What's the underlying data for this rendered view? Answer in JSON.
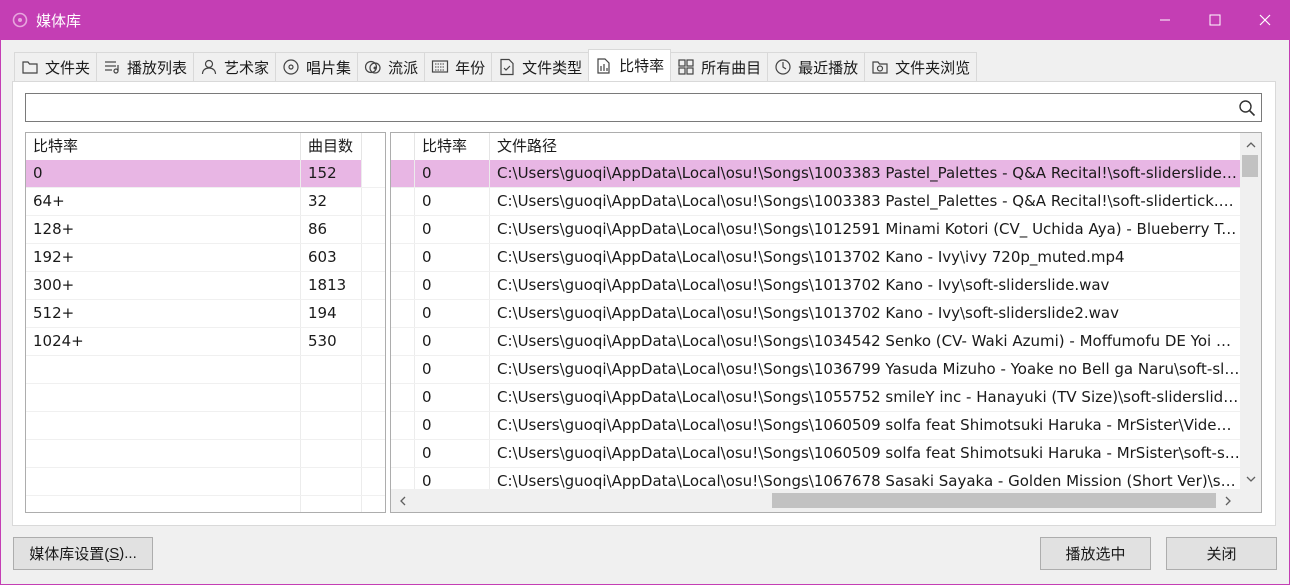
{
  "window": {
    "title": "媒体库",
    "accent": "#c43eb4",
    "selection_color": "#e8b6e4"
  },
  "tabs": [
    {
      "label": "文件夹",
      "icon": "folder-icon",
      "active": false
    },
    {
      "label": "播放列表",
      "icon": "playlist-icon",
      "active": false
    },
    {
      "label": "艺术家",
      "icon": "person-icon",
      "active": false
    },
    {
      "label": "唱片集",
      "icon": "disc-icon",
      "active": false
    },
    {
      "label": "流派",
      "icon": "genre-icon",
      "active": false
    },
    {
      "label": "年份",
      "icon": "calendar-icon",
      "active": false
    },
    {
      "label": "文件类型",
      "icon": "file-type-icon",
      "active": false
    },
    {
      "label": "比特率",
      "icon": "bitrate-icon",
      "active": true
    },
    {
      "label": "所有曲目",
      "icon": "grid-icon",
      "active": false
    },
    {
      "label": "最近播放",
      "icon": "recent-icon",
      "active": false
    },
    {
      "label": "文件夹浏览",
      "icon": "folder-browse-icon",
      "active": false
    }
  ],
  "search": {
    "value": "",
    "placeholder": ""
  },
  "left_list": {
    "headers": [
      "比特率",
      "曲目数"
    ],
    "rows": [
      [
        "0",
        "152"
      ],
      [
        "64+",
        "32"
      ],
      [
        "128+",
        "86"
      ],
      [
        "192+",
        "603"
      ],
      [
        "300+",
        "1813"
      ],
      [
        "512+",
        "194"
      ],
      [
        "1024+",
        "530"
      ]
    ],
    "selected_index": 0
  },
  "right_list": {
    "headers": [
      "",
      "比特率",
      "文件路径"
    ],
    "rows": [
      [
        "0",
        "C:\\Users\\guoqi\\AppData\\Local\\osu!\\Songs\\1003383 Pastel_Palettes - Q&A Recital!\\soft-sliderslide...."
      ],
      [
        "0",
        "C:\\Users\\guoqi\\AppData\\Local\\osu!\\Songs\\1003383 Pastel_Palettes - Q&A Recital!\\soft-slidertick.wav"
      ],
      [
        "0",
        "C:\\Users\\guoqi\\AppData\\Local\\osu!\\Songs\\1012591 Minami Kotori (CV_ Uchida Aya) - Blueberry Tra..."
      ],
      [
        "0",
        "C:\\Users\\guoqi\\AppData\\Local\\osu!\\Songs\\1013702 Kano - Ivy\\ivy 720p_muted.mp4"
      ],
      [
        "0",
        "C:\\Users\\guoqi\\AppData\\Local\\osu!\\Songs\\1013702 Kano - Ivy\\soft-sliderslide.wav"
      ],
      [
        "0",
        "C:\\Users\\guoqi\\AppData\\Local\\osu!\\Songs\\1013702 Kano - Ivy\\soft-sliderslide2.wav"
      ],
      [
        "0",
        "C:\\Users\\guoqi\\AppData\\Local\\osu!\\Songs\\1034542 Senko (CV- Waki Azumi) - Moffumofu DE Yoi no..."
      ],
      [
        "0",
        "C:\\Users\\guoqi\\AppData\\Local\\osu!\\Songs\\1036799 Yasuda Mizuho - Yoake no Bell ga Naru\\soft-sli..."
      ],
      [
        "0",
        "C:\\Users\\guoqi\\AppData\\Local\\osu!\\Songs\\1055752 smileY inc - Hanayuki (TV Size)\\soft-sliderslide...."
      ],
      [
        "0",
        "C:\\Users\\guoqi\\AppData\\Local\\osu!\\Songs\\1060509 solfa feat Shimotsuki Haruka - MrSister\\Video...."
      ],
      [
        "0",
        "C:\\Users\\guoqi\\AppData\\Local\\osu!\\Songs\\1060509 solfa feat Shimotsuki Haruka - MrSister\\soft-sli..."
      ],
      [
        "0",
        "C:\\Users\\guoqi\\AppData\\Local\\osu!\\Songs\\1067678 Sasaki Sayaka - Golden Mission (Short Ver)\\soft..."
      ]
    ],
    "selected_index": 0
  },
  "buttons": {
    "settings_prefix": "媒体库设置(",
    "settings_key": "S",
    "settings_suffix": ")...",
    "play_selected": "播放选中",
    "close": "关闭"
  }
}
